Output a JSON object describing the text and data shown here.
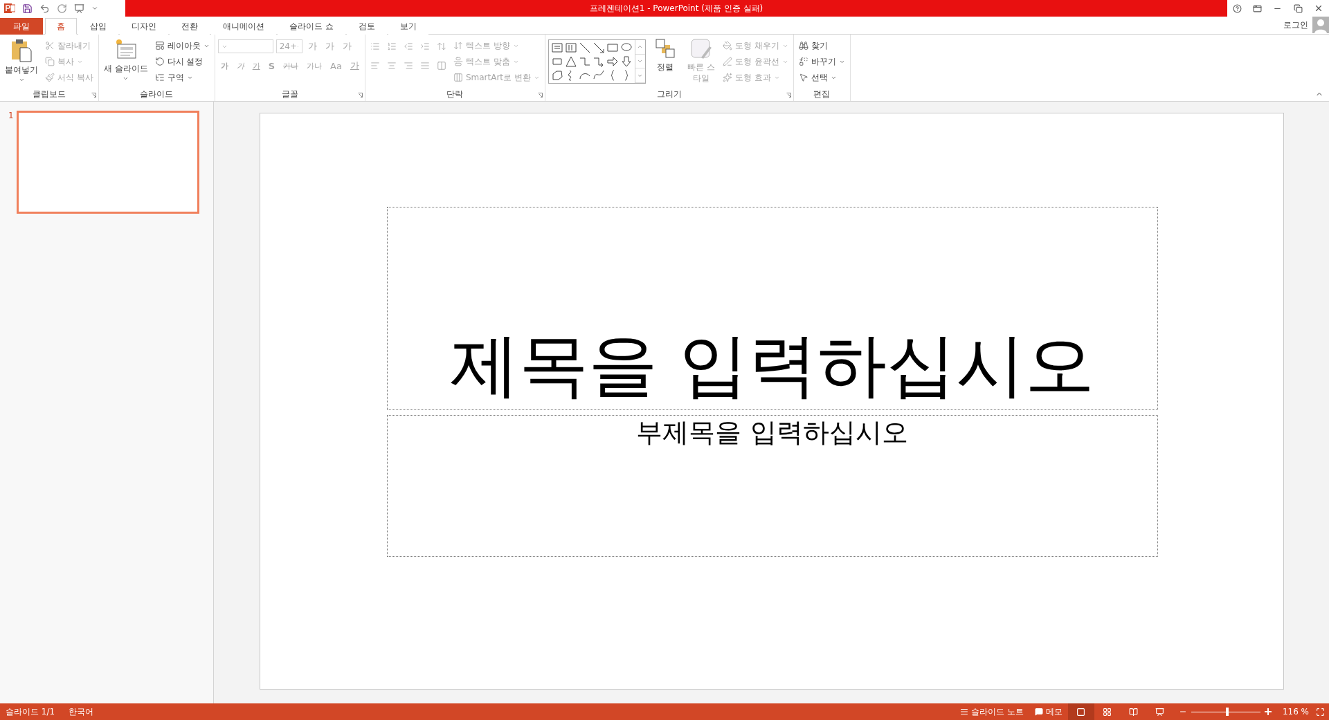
{
  "window": {
    "title": "프레젠테이션1 -  PowerPoint (제품 인증 실패)"
  },
  "tabs": [
    {
      "label": "파일",
      "kind": "file",
      "selected": false
    },
    {
      "label": "홈",
      "kind": "tab",
      "selected": true
    },
    {
      "label": "삽입",
      "kind": "tab",
      "selected": false
    },
    {
      "label": "디자인",
      "kind": "tab",
      "selected": false
    },
    {
      "label": "전환",
      "kind": "tab",
      "selected": false
    },
    {
      "label": "애니메이션",
      "kind": "tab",
      "selected": false
    },
    {
      "label": "슬라이드 쇼",
      "kind": "tab",
      "selected": false
    },
    {
      "label": "검토",
      "kind": "tab",
      "selected": false
    },
    {
      "label": "보기",
      "kind": "tab",
      "selected": false
    }
  ],
  "account": {
    "label": "로그인"
  },
  "ribbon": {
    "groups": [
      {
        "kind": "clipboard",
        "label": "클립보드",
        "launcher": true,
        "large": [
          {
            "label": "붙여넣기",
            "disabled": false
          }
        ],
        "small": [
          {
            "label": "잘라내기",
            "disabled": true,
            "caret": false
          },
          {
            "label": "복사",
            "disabled": true,
            "caret": true
          },
          {
            "label": "서식 복사",
            "disabled": true,
            "caret": false
          }
        ]
      },
      {
        "kind": "slides",
        "label": "슬라이드",
        "launcher": false,
        "large": [
          {
            "label": "새 슬라이드",
            "disabled": false
          }
        ],
        "small": [
          {
            "label": "레이아웃",
            "disabled": false,
            "caret": true
          },
          {
            "label": "다시 설정",
            "disabled": false,
            "caret": false
          },
          {
            "label": "구역",
            "disabled": false,
            "caret": true
          }
        ]
      },
      {
        "kind": "font",
        "label": "글꼴",
        "launcher": true,
        "disabled": true,
        "size_value": "24+",
        "row1_glyphs": [
          "가",
          "가",
          "가"
        ],
        "row2_glyphs": [
          "가",
          "가",
          "가",
          "S",
          "가나",
          "가나",
          "Aa",
          "가"
        ]
      },
      {
        "kind": "paragraph",
        "label": "단락",
        "launcher": true,
        "small": [
          {
            "label": "텍스트 방향",
            "disabled": true,
            "caret": true
          },
          {
            "label": "텍스트 맞춤",
            "disabled": true,
            "caret": true
          },
          {
            "label": "SmartArt로 변환",
            "disabled": true,
            "caret": true
          }
        ]
      },
      {
        "kind": "drawing",
        "label": "그리기",
        "launcher": true,
        "large": [
          {
            "label": "정렬",
            "disabled": false
          },
          {
            "label": "빠른 스타일",
            "disabled": true
          }
        ],
        "small": [
          {
            "label": "도형 채우기",
            "disabled": true,
            "caret": true
          },
          {
            "label": "도형 윤곽선",
            "disabled": true,
            "caret": true
          },
          {
            "label": "도형 효과",
            "disabled": true,
            "caret": true
          }
        ]
      },
      {
        "kind": "editing",
        "label": "편집",
        "launcher": false,
        "small": [
          {
            "label": "찾기",
            "disabled": false,
            "caret": false
          },
          {
            "label": "바꾸기",
            "disabled": false,
            "caret": true
          },
          {
            "label": "선택",
            "disabled": false,
            "caret": true
          }
        ]
      }
    ]
  },
  "slides": [
    {
      "number": "1",
      "selected": true
    }
  ],
  "slide": {
    "title_placeholder": "제목을 입력하십시오",
    "subtitle_placeholder": "부제목을 입력하십시오"
  },
  "status_bar": {
    "slide_info": "슬라이드 1/1",
    "language": "한국어",
    "notes": "슬라이드 노트",
    "comments": "메모",
    "views": [
      {
        "selected": true
      },
      {
        "selected": false
      },
      {
        "selected": false
      },
      {
        "selected": false
      }
    ],
    "zoom": {
      "level": 0.52,
      "label": "116 %"
    }
  }
}
